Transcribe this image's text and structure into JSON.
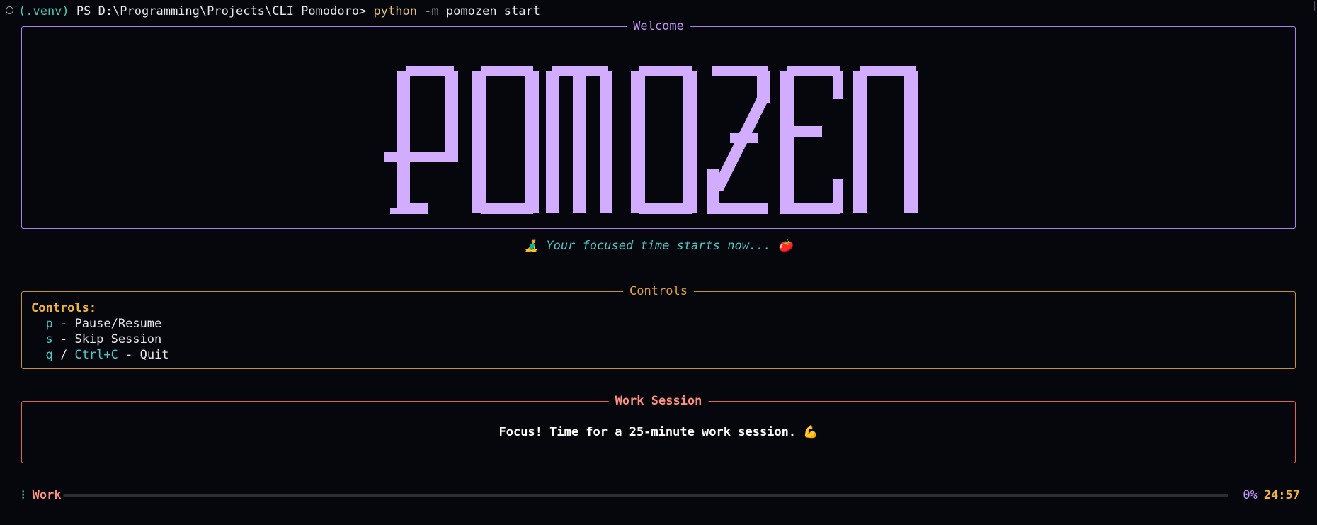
{
  "terminal": {
    "prompt_env": "(.venv)",
    "prompt_path": " PS D:\\Programming\\Projects\\CLI Pomodoro> ",
    "cmd_python": "python",
    "cmd_flag": " -m",
    "cmd_rest": " pomozen start"
  },
  "welcome": {
    "title": "Welcome",
    "logo_text": "POMOZEN"
  },
  "tagline": "🧘‍♂️ Your focused time starts now... 🍅",
  "controls": {
    "title": "Controls",
    "heading": "Controls:",
    "items": [
      {
        "key": "p",
        "sep": " - ",
        "desc": "Pause/Resume"
      },
      {
        "key": "s",
        "sep": " - ",
        "desc": "Skip Session"
      },
      {
        "key": "q",
        "mid": " / ",
        "key2": "Ctrl+C",
        "sep": " - ",
        "desc": "Quit"
      }
    ]
  },
  "work_session": {
    "title": "Work Session",
    "message": "Focus! Time for a 25-minute work session. 💪"
  },
  "status": {
    "spinner": "⁝",
    "label": "Work",
    "progress_percent": 0,
    "percent_text": "0%",
    "time_remaining": "24:57"
  },
  "colors": {
    "logo": "#d2acff",
    "accent_purple": "#c896ff",
    "accent_orange": "#e8a33a",
    "accent_red": "#e0605a",
    "accent_cyan": "#4ec9c9"
  }
}
